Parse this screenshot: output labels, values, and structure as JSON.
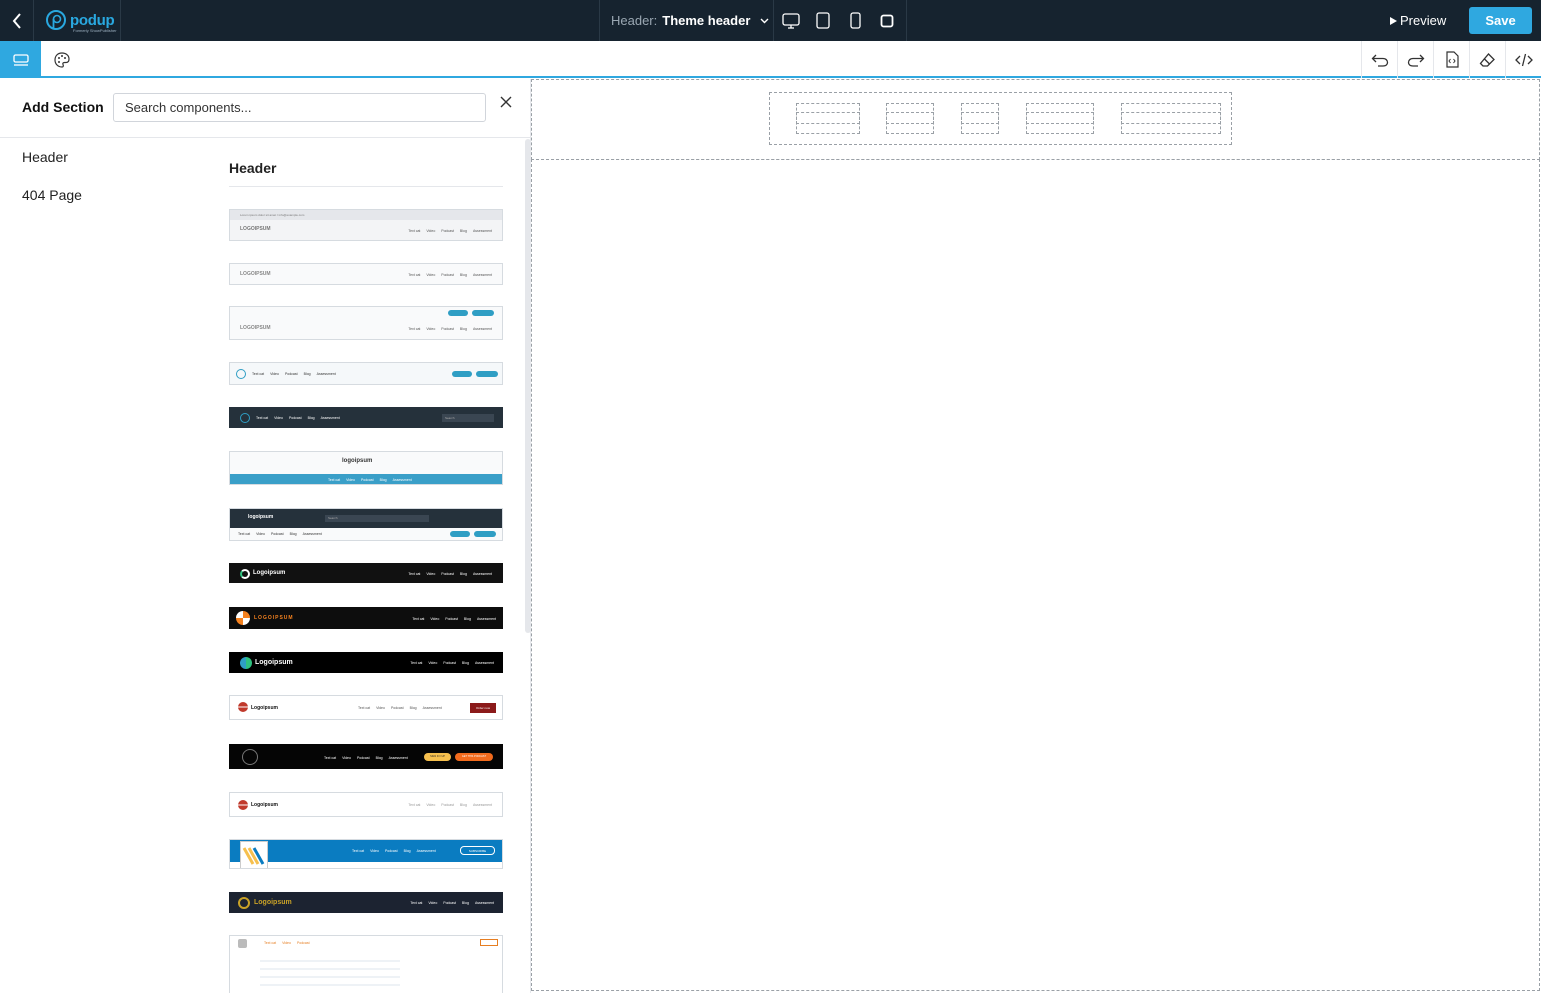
{
  "topbar": {
    "brand": "podup",
    "brand_sub": "Formerly ShowPublisher",
    "header_label": "Header:",
    "header_value": "Theme header",
    "preview_label": "Preview",
    "save_label": "Save"
  },
  "panel": {
    "title": "Add Section",
    "search_placeholder": "Search components...",
    "categories": [
      "Header",
      "404 Page"
    ],
    "section_title": "Header"
  },
  "thumbs": {
    "logo_a": "LOGOIPSUM",
    "logo_b": "logoipsum",
    "logo_c": "Logoipsum",
    "nav": [
      "Text cat",
      "Video",
      "Podcast",
      "Blog",
      "Assessment"
    ],
    "login": "Login",
    "signup": "Sign Up",
    "search": "Search",
    "order": "Order now",
    "signin": "SIGN IN / UP",
    "get_podcast": "GET THIS PODCAST",
    "subscribe": "SUBSCRIBE",
    "contact": "Lorem ipsum dolor sit amet / info@example.com"
  },
  "colors": {
    "topbar_bg": "#16232f",
    "accent": "#2fa8e0",
    "canvas_bg": "#ffffff"
  }
}
